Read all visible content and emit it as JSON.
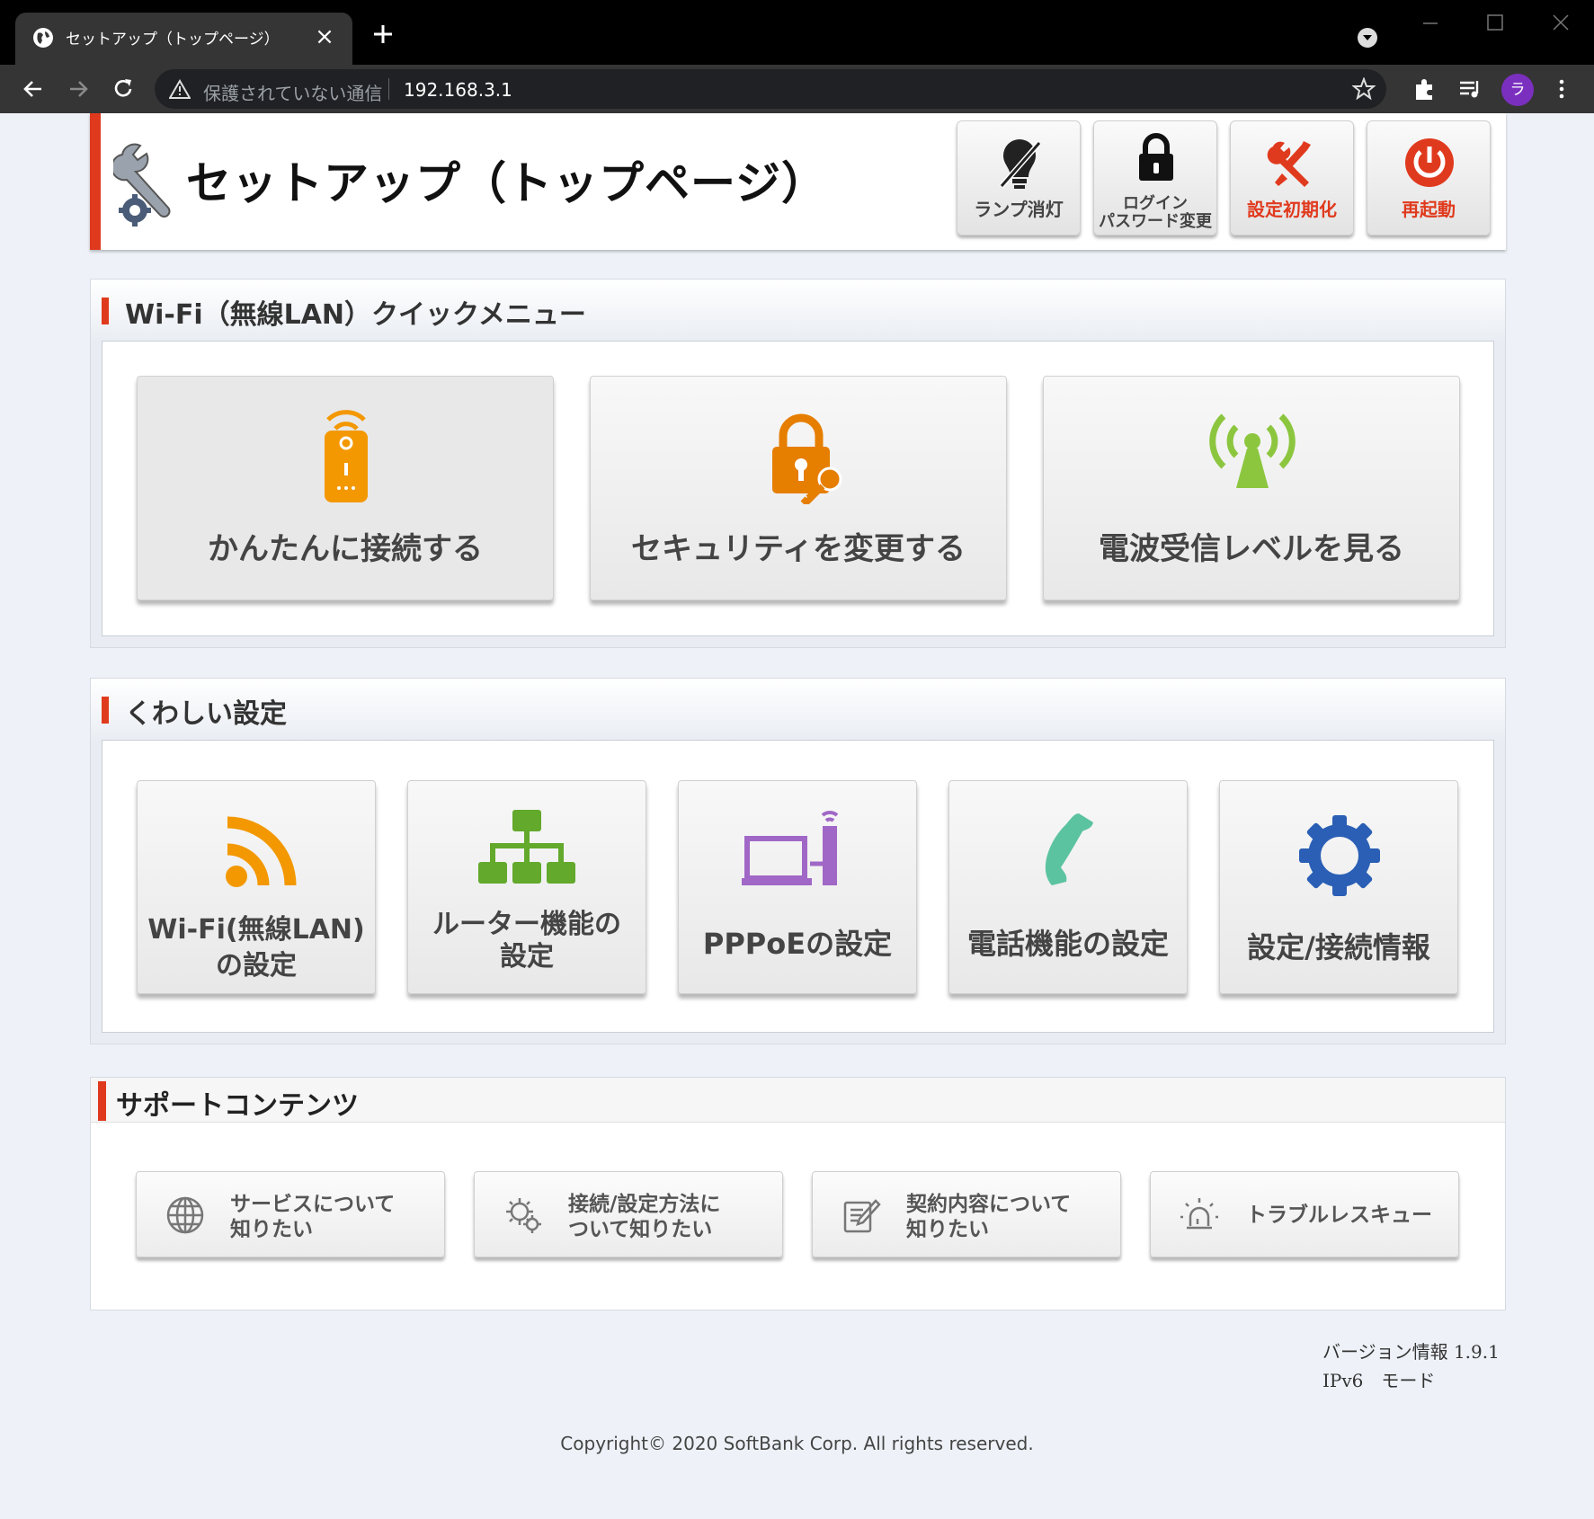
{
  "browser": {
    "tab_title": "セットアップ（トップページ）",
    "tab_close": "×",
    "security_warning": "保護されていない通信",
    "url": "192.168.3.1",
    "profile_initial": "ラ"
  },
  "header": {
    "title": "セットアップ（トップページ）",
    "buttons": [
      {
        "label": "ランプ消灯",
        "icon": "lamp-off-icon"
      },
      {
        "label_line1": "ログイン",
        "label_line2": "パスワード変更",
        "icon": "lock-icon"
      },
      {
        "label": "設定初期化",
        "icon": "tools-icon"
      },
      {
        "label": "再起動",
        "icon": "power-icon"
      }
    ]
  },
  "quick_menu": {
    "title": "Wi-Fi（無線LAN）クイックメニュー",
    "items": [
      {
        "label": "かんたんに接続する",
        "icon": "wps-icon"
      },
      {
        "label": "セキュリティを変更する",
        "icon": "lock-key-icon"
      },
      {
        "label": "電波受信レベルを見る",
        "icon": "antenna-icon"
      }
    ]
  },
  "detail_settings": {
    "title": "くわしい設定",
    "items": [
      {
        "line1": "Wi-Fi(無線LAN)",
        "line2": "の設定",
        "icon": "wifi-icon"
      },
      {
        "line1": "ルーター機能の",
        "line2": "設定",
        "icon": "network-icon"
      },
      {
        "line1": "PPPoEの設定",
        "icon": "laptop-router-icon"
      },
      {
        "line1": "電話機能の設定",
        "icon": "phone-icon"
      },
      {
        "line1": "設定/接続情報",
        "icon": "gear-icon"
      }
    ]
  },
  "support": {
    "title": "サポートコンテンツ",
    "items": [
      {
        "line1": "サービスについて",
        "line2": "知りたい",
        "icon": "globe-icon"
      },
      {
        "line1": "接続/設定方法に",
        "line2": "ついて知りたい",
        "icon": "gears-icon"
      },
      {
        "line1": "契約内容について",
        "line2": "知りたい",
        "icon": "contract-icon"
      },
      {
        "line1": "トラブルレスキュー",
        "icon": "alarm-icon"
      }
    ]
  },
  "footer": {
    "version": "バージョン情報 1.9.1",
    "mode": "IPv6　モード",
    "copyright": "Copyright© 2020 SoftBank Corp. All rights reserved."
  },
  "colors": {
    "accent_red": "#e03a1e",
    "wifi_orange": "#f39800",
    "network_green": "#62a92c",
    "pppoe_purple": "#a067c6",
    "phone_teal": "#5cc3a0",
    "gear_blue": "#2a5fb5"
  }
}
